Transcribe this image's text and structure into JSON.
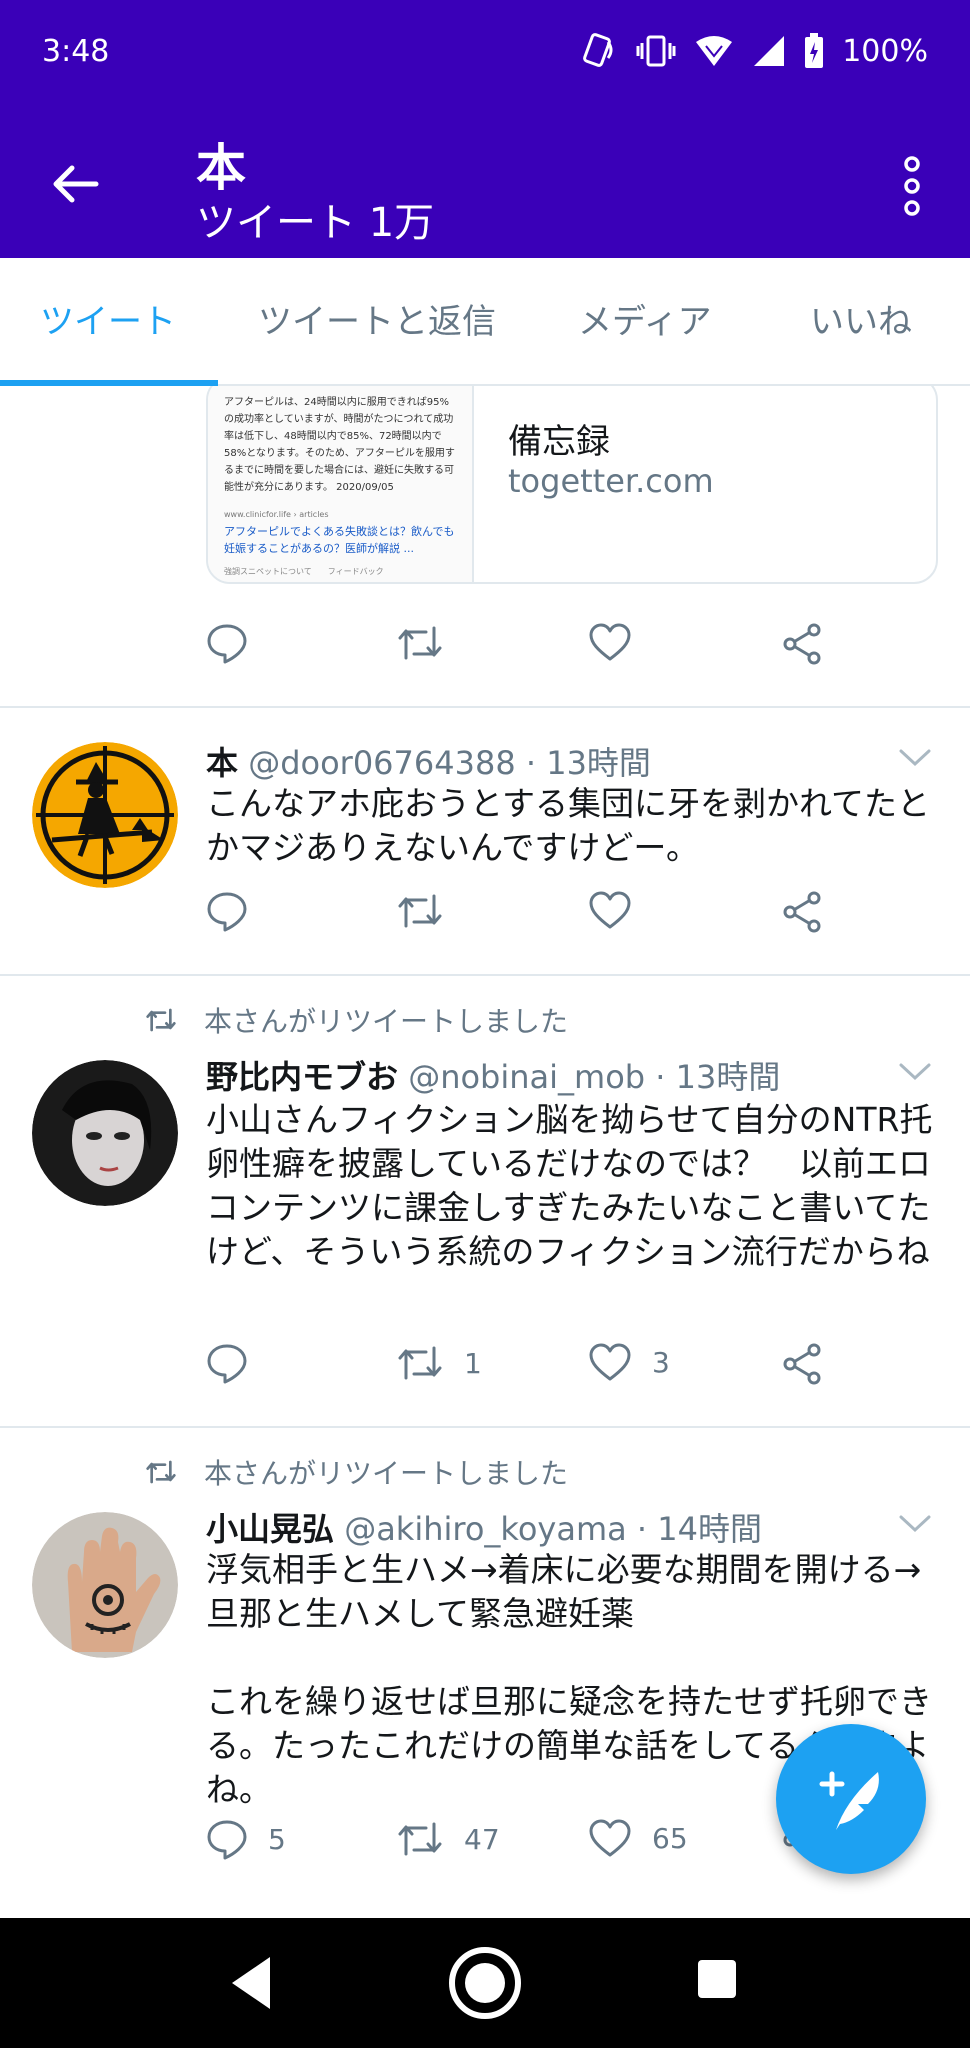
{
  "status_bar": {
    "time": "3:48",
    "battery": "100%"
  },
  "app_bar": {
    "title": "本",
    "subtitle": "ツイート 1万"
  },
  "tabs": [
    {
      "label": "ツイート",
      "active": true
    },
    {
      "label": "ツイートと返信",
      "active": false
    },
    {
      "label": "メディア",
      "active": false
    },
    {
      "label": "いいね",
      "active": false
    }
  ],
  "link_card": {
    "title": "備忘録",
    "domain": "togetter.com",
    "thumb": {
      "text": "アフターピルは、24時間以内に服用できれば95%の成功率としていますが、時間がたつにつれて成功率は低下し、48時間以内で85%、72時間以内で58%となります。そのため、アフターピルを服用するまでに時間を要した場合には、避妊に失敗する可能性が充分にあります。 2020/09/05",
      "source": "www.clinicfor.life › articles",
      "link": "アフターピルでよくある失敗談とは？飲んでも妊娠することがあるの？医師が解説 ...",
      "footer": "強調スニペットについて　　フィードバック"
    }
  },
  "tweets": [
    {
      "retweeted_by": "",
      "name": "本",
      "handle": "@door06764388",
      "time": "13時間",
      "text": "こんなアホ庇おうとする集団に牙を剥かれてたとかマジありえないんですけどー。",
      "replies": "",
      "retweets": "",
      "likes": ""
    },
    {
      "retweeted_by": "本さんがリツイートしました",
      "name": "野比内モブお",
      "handle": "@nobinai_mob",
      "time": "13時間",
      "text": "小山さんフィクション脳を拗らせて自分のNTR托卵性癖を披露しているだけなのでは？　以前エロコンテンツに課金しすぎたみたいなこと書いてたけど、そういう系統のフィクション流行だからね",
      "replies": "",
      "retweets": "1",
      "likes": "3"
    },
    {
      "retweeted_by": "本さんがリツイートしました",
      "name": "小山晃弘",
      "handle": "@akihiro_koyama",
      "time": "14時間",
      "text": "浮気相手と生ハメ→着床に必要な期間を開ける→旦那と生ハメして緊急避妊薬\n\nこれを繰り返せば旦那に疑念を持たせず托卵できる。たったこれだけの簡単な話をしてるんですよね。",
      "replies": "5",
      "retweets": "47",
      "likes": "65"
    }
  ],
  "colors": {
    "header": "#3a00b8",
    "accent": "#1da1f2",
    "muted": "#657786"
  },
  "icons": [
    "back-arrow-icon",
    "more-vert-icon",
    "reply-icon",
    "retweet-icon",
    "like-icon",
    "share-icon",
    "compose-icon"
  ]
}
